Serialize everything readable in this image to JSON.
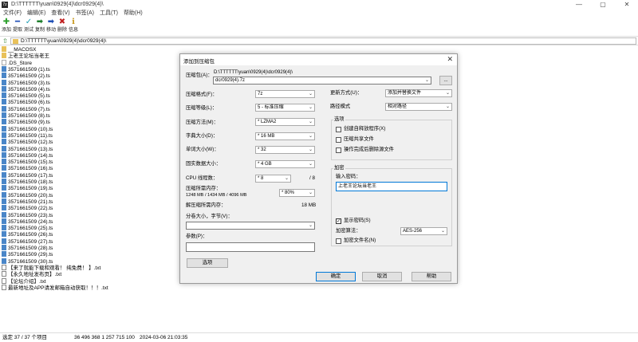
{
  "window": {
    "title": "D:\\TTTTTT\\yuan\\0929(4)\\dcr0929(4)\\",
    "app_icon": "7z"
  },
  "menu": [
    "文件(F)",
    "编辑(E)",
    "查看(V)",
    "书签(A)",
    "工具(T)",
    "帮助(H)"
  ],
  "toolbar": [
    {
      "label": "添加",
      "icon": "+",
      "color": "#2da02d"
    },
    {
      "label": "提取",
      "icon": "━",
      "color": "#1f4fb5"
    },
    {
      "label": "测试",
      "icon": "✓",
      "color": "#1f9fb5"
    },
    {
      "label": "复制",
      "icon": "➡",
      "color": "#1f7f2d"
    },
    {
      "label": "移动",
      "icon": "➡",
      "color": "#1f4fb5"
    },
    {
      "label": "删除",
      "icon": "✖",
      "color": "#c01f1f"
    },
    {
      "label": "信息",
      "icon": "ℹ",
      "color": "#c89a1f"
    }
  ],
  "address": {
    "path": "D:\\TTTTTT\\yuan\\0929(4)\\dcr0929(4)\\"
  },
  "files": [
    {
      "name": "__MACOSX",
      "type": "folder"
    },
    {
      "name": "上老王论坛当老王",
      "type": "folder"
    },
    {
      "name": ".DS_Store",
      "type": "doc"
    },
    {
      "name": "3571661509 (1).ts",
      "type": "ts"
    },
    {
      "name": "3571661509 (2).ts",
      "type": "ts"
    },
    {
      "name": "3571661509 (3).ts",
      "type": "ts"
    },
    {
      "name": "3571661509 (4).ts",
      "type": "ts"
    },
    {
      "name": "3571661509 (5).ts",
      "type": "ts"
    },
    {
      "name": "3571661509 (6).ts",
      "type": "ts"
    },
    {
      "name": "3571661509 (7).ts",
      "type": "ts"
    },
    {
      "name": "3571661509 (8).ts",
      "type": "ts"
    },
    {
      "name": "3571661509 (9).ts",
      "type": "ts"
    },
    {
      "name": "3571661509 (10).ts",
      "type": "ts"
    },
    {
      "name": "3571661509 (11).ts",
      "type": "ts"
    },
    {
      "name": "3571661509 (12).ts",
      "type": "ts"
    },
    {
      "name": "3571661509 (13).ts",
      "type": "ts"
    },
    {
      "name": "3571661509 (14).ts",
      "type": "ts"
    },
    {
      "name": "3571661509 (15).ts",
      "type": "ts"
    },
    {
      "name": "3571661509 (16).ts",
      "type": "ts"
    },
    {
      "name": "3571661509 (17).ts",
      "type": "ts"
    },
    {
      "name": "3571661509 (18).ts",
      "type": "ts"
    },
    {
      "name": "3571661509 (19).ts",
      "type": "ts"
    },
    {
      "name": "3571661509 (20).ts",
      "type": "ts"
    },
    {
      "name": "3571661509 (21).ts",
      "type": "ts"
    },
    {
      "name": "3571661509 (22).ts",
      "type": "ts"
    },
    {
      "name": "3571661509 (23).ts",
      "type": "ts"
    },
    {
      "name": "3571661509 (24).ts",
      "type": "ts"
    },
    {
      "name": "3571661509 (25).ts",
      "type": "ts"
    },
    {
      "name": "3571661509 (26).ts",
      "type": "ts"
    },
    {
      "name": "3571661509 (27).ts",
      "type": "ts"
    },
    {
      "name": "3571661509 (28).ts",
      "type": "ts"
    },
    {
      "name": "3571661509 (29).ts",
      "type": "ts"
    },
    {
      "name": "3571661509 (30).ts",
      "type": "ts"
    },
    {
      "name": "【来了就能下载和观看！ 纯免费！ 】.txt",
      "type": "txt"
    },
    {
      "name": "【永久地址发布页】.txt",
      "type": "txt"
    },
    {
      "name": "【论坛介绍】.txt",
      "type": "txt"
    },
    {
      "name": "最新地址及APP请发邮箱自动获取！！！.txt",
      "type": "txt"
    }
  ],
  "status": {
    "selected": "选定 37 / 37 个项目",
    "sizes": "36 496 368  1 257 715 100",
    "date": "2024-03-06 21:03:35"
  },
  "dialog": {
    "title": "添加到压缩包",
    "archive_label": "压缩包(A)：",
    "archive_dir": "D:\\TTTTTT\\yuan\\0929(4)\\dcr0929(4)\\",
    "archive_name": "dcr0929(4).7z",
    "browse_label": "...",
    "format_label": "压缩格式(F)：",
    "format_value": "7z",
    "level_label": "压缩等级(L)：",
    "level_value": "5 - 标准压缩",
    "method_label": "压缩方法(M)：",
    "method_value": "* LZMA2",
    "dict_label": "字典大小(D)：",
    "dict_value": "* 16 MB",
    "word_label": "单词大小(W)：",
    "word_value": "* 32",
    "solid_label": "固实数据大小：",
    "solid_value": "* 4 GB",
    "threads_label": "CPU 线程数：",
    "threads_value": "* 8",
    "threads_max": "/ 8",
    "mem_label": "压缩所需内存：",
    "mem_detail": "1248 MB / 1434 MB / 4096 MB",
    "mem_pct": "* 80%",
    "demem_label": "解压缩所需内存：",
    "demem_value": "18 MB",
    "split_label": "分卷大小，字节(V)：",
    "split_value": "",
    "params_label": "参数(P)：",
    "params_value": "",
    "options_button": "选项",
    "update_label": "更新方式(U)：",
    "update_value": "添加并替换文件",
    "pathmode_label": "路径模式",
    "pathmode_value": "相对路径",
    "options_group": "选项",
    "opt_sfx": "创建自释放程序(X)",
    "opt_shared": "压缩共享文件",
    "opt_delete": "操作完成后删除源文件",
    "enc_group": "加密",
    "password_label": "输入密码：",
    "password_value": "上老王论坛当老王",
    "show_pwd": "显示密码(S)",
    "enc_method_label": "加密算法：",
    "enc_method_value": "AES-256",
    "enc_names": "加密文件名(N)",
    "ok": "确定",
    "cancel": "取消",
    "help": "帮助"
  }
}
